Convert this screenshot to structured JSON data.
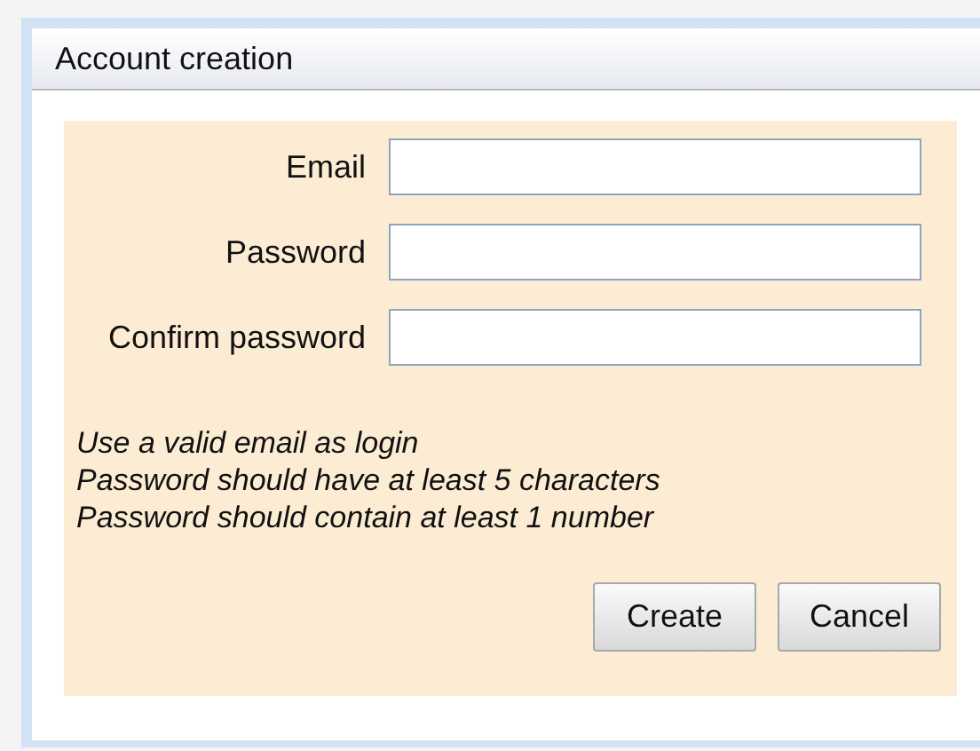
{
  "window": {
    "title": "Account creation"
  },
  "fields": [
    {
      "label": "Email"
    },
    {
      "label": "Password"
    },
    {
      "label": "Confirm password"
    }
  ],
  "hints": [
    "Use a valid email as login",
    "Password should have at least 5 characters",
    "Password should contain at least 1 number"
  ],
  "buttons": [
    "Create",
    "Cancel"
  ]
}
